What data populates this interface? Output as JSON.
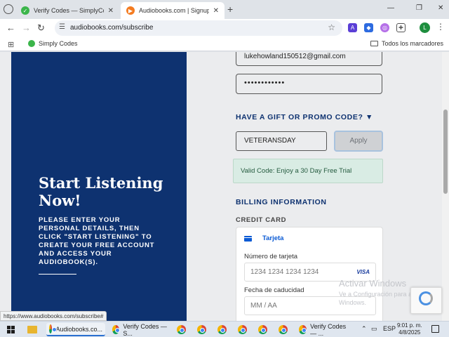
{
  "browser": {
    "tabs": [
      {
        "label": "Verify Codes — SimplyCodes",
        "active": false
      },
      {
        "label": "Audiobooks.com | Signup for a",
        "active": true
      }
    ],
    "url": "audiobooks.com/subscribe",
    "bookmarks": {
      "item": "Simply Codes",
      "all": "Todos los marcadores"
    },
    "profile_initial": "L",
    "status_url": "https://www.audiobooks.com/subscribe#"
  },
  "hero": {
    "title": "Start Listening Now!",
    "body": "PLEASE ENTER YOUR PERSONAL DETAILS, THEN CLICK \"START LISTENING\" TO CREATE YOUR FREE ACCOUNT AND ACCESS YOUR AUDIOBOOK(S)."
  },
  "form": {
    "email_value": "lukehowland150512@gmail.com",
    "password_value": "••••••••••••",
    "gift_heading": "HAVE A GIFT OR PROMO CODE?",
    "promo_value": "VETERANSDAY",
    "apply_label": "Apply",
    "valid_message": "Valid Code: Enjoy a 30 Day Free Trial",
    "billing_heading": "BILLING INFORMATION",
    "credit_card_heading": "CREDIT CARD",
    "card": {
      "tab_label": "Tarjeta",
      "number_label": "Número de tarjeta",
      "number_placeholder": "1234 1234 1234 1234",
      "brand": "VISA",
      "expiry_label": "Fecha de caducidad",
      "expiry_placeholder": "MM / AA"
    }
  },
  "watermark": {
    "title": "Activar Windows",
    "subtitle": "Ve a Configuración para activar Windows."
  },
  "taskbar": {
    "apps": [
      {
        "label": "Audiobooks.co..."
      },
      {
        "label": "Verify Codes — S..."
      },
      {
        "label": "Verify Codes — ..."
      }
    ],
    "language": "ESP",
    "time": "9:01 p. m.",
    "date": "4/8/2025"
  },
  "colors": {
    "hero_bg": "#0e3270",
    "accent_blue": "#0e3270",
    "valid_bg": "#d9ece4",
    "card_link": "#0a5ad4"
  }
}
